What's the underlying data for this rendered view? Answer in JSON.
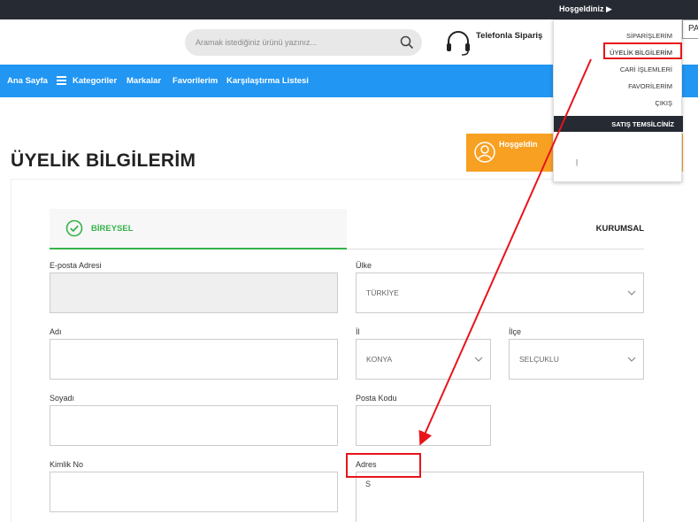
{
  "topbar": {
    "welcome": "Hoşgeldiniz ▶"
  },
  "header": {
    "search_placeholder": "Aramak istediğiniz ürünü yazınız...",
    "phone_label": "Telefonla Sipariş",
    "pa_text": "PA"
  },
  "nav": {
    "items": [
      "Ana Sayfa",
      "Kategoriler",
      "Markalar",
      "Favorilerim",
      "Karşılaştırma Listesi"
    ]
  },
  "dropdown": {
    "items": [
      "SİPARİŞLERİM",
      "ÜYELİK BİLGİLERİM",
      "CARİ İŞLEMLERİ",
      "FAVORİLERİM",
      "ÇIKIŞ"
    ],
    "section": "SATIŞ TEMSİLCİNİZ",
    "rep_value": "|"
  },
  "welcome_box": {
    "text": "Hoşgeldin"
  },
  "page": {
    "title": "ÜYELİK BİLGİLERİM"
  },
  "tabs": {
    "bireysel": "BİREYSEL",
    "kurumsal": "KURUMSAL"
  },
  "form": {
    "email_label": "E-posta Adresi",
    "email_value": "",
    "country_label": "Ülke",
    "country_value": "TÜRKİYE",
    "name_label": "Adı",
    "name_value": "",
    "city_label": "İl",
    "city_value": "KONYA",
    "district_label": "İlçe",
    "district_value": "SELÇUKLU",
    "surname_label": "Soyadı",
    "surname_value": "",
    "postal_label": "Posta Kodu",
    "postal_value": "",
    "id_label": "Kimlik No",
    "id_value": "",
    "address_label": "Adres",
    "address_value": "S"
  },
  "annotation": {
    "color": "#e8141b"
  },
  "colors": {
    "nav": "#2196f3",
    "topbar": "#262b33",
    "accent_green": "#35b34a",
    "orange": "#f8a022"
  }
}
